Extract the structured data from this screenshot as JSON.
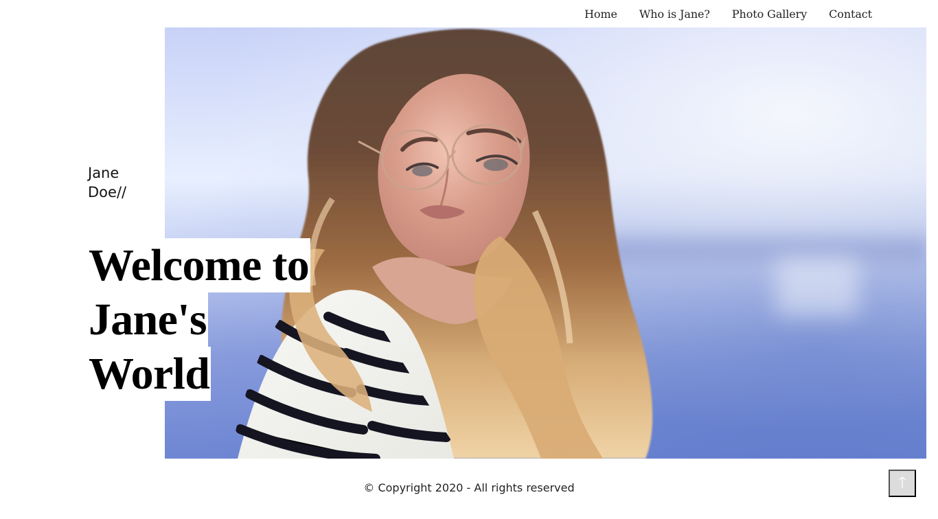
{
  "navigation": {
    "items": [
      {
        "label": "Home"
      },
      {
        "label": "Who is Jane?"
      },
      {
        "label": "Photo Gallery"
      },
      {
        "label": "Contact"
      }
    ]
  },
  "hero": {
    "brand_line_1": "Jane",
    "brand_line_2": "Doe//",
    "headline_lines": [
      "Welcome to",
      "Jane's",
      "World"
    ]
  },
  "footer": {
    "copyright": "© Copyright 2020 - All rights reserved"
  },
  "controls": {
    "scroll_top_icon": "arrow-up-icon",
    "scroll_top_glyph": "🡑"
  },
  "colors": {
    "page_background": "#ffffff",
    "text_primary": "#111111",
    "scroll_button": "#dcdcdc",
    "sky_blue": "#c8d2f7",
    "water_blue": "#6e86d3",
    "sweater_stripe": "#151522"
  }
}
